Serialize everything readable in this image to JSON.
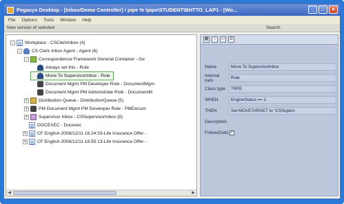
{
  "window": {
    "title": "Pegasys Desktop - [Inbox/Demo Controller] / pipe % \\pipe\\STUDENT\\BHTTO_LAP1 - [Wo..."
  },
  "menubar": {
    "items": [
      "File",
      "Options",
      "Tools",
      "Window",
      "Help"
    ]
  },
  "toolstrip": {
    "left_label": "New version of selected",
    "search_label": "Search"
  },
  "tree": [
    {
      "label": "Workplace - CSClerkInbox (4)",
      "icon": "document-icon",
      "expander": "-",
      "selected": false
    },
    {
      "label": "CS Clerk Inbox Agent - Agent (6)",
      "icon": "agent-icon",
      "expander": "-",
      "selected": false
    },
    {
      "label": "Correspondence Framework General Container - Ge",
      "icon": "container-icon",
      "expander": "-",
      "selected": false
    },
    {
      "label": "Always set this - Rule",
      "icon": "rule-icon",
      "expander": "",
      "selected": false
    },
    {
      "label": "Move To SupervisorInbox - Rule",
      "icon": "rule-icon",
      "expander": "",
      "selected": true
    },
    {
      "label": "Document Mgmt PM Developer Role - DocumentMgm",
      "icon": "role-icon",
      "expander": "",
      "selected": false
    },
    {
      "label": "Document Mgmt PM Administrate Role - DocumentM",
      "icon": "role-icon",
      "expander": "",
      "selected": false
    },
    {
      "label": "Distribution Queue - DistributionQueue (5)",
      "icon": "queue-icon",
      "expander": "+",
      "selected": false
    },
    {
      "label": "PM Document Mgmt PM Developer Role - PMDocum",
      "icon": "role-icon",
      "expander": "+",
      "selected": false
    },
    {
      "label": "Supervisor Inbox - CSSupervisorInbox (8)",
      "icon": "inbox-icon",
      "expander": "+",
      "selected": false
    },
    {
      "label": "DOCEXEC - Docexec",
      "icon": "document-icon",
      "expander": "",
      "selected": false
    },
    {
      "label": "CF English-2006/12/11 16:24:33-Life Insurance Offer -",
      "icon": "document-icon",
      "expander": "+",
      "selected": false
    },
    {
      "label": "CF English-2006/12/11 16:55:13-Life Insurance Offer -",
      "icon": "document-icon",
      "expander": "+",
      "selected": false
    }
  ],
  "properties": {
    "toolbar_icons": [
      "grid-view-icon",
      "sort-icon",
      "page-icon",
      "options-icon"
    ],
    "rows": [
      {
        "label": "Name",
        "value": "Move To SupervisorInbox"
      },
      {
        "label": "Internal nam",
        "value": "Rule"
      },
      {
        "label": "Class type",
        "value": "TRFE"
      },
      {
        "label": "WHEN",
        "value": "EngineStatus == 1"
      },
      {
        "label": "THEN",
        "value": "Set MOVETARGET to \"CSSuperv"
      },
      {
        "label": "Description",
        "value": ""
      },
      {
        "label": "Follow(Deb)",
        "value": ""
      }
    ]
  }
}
